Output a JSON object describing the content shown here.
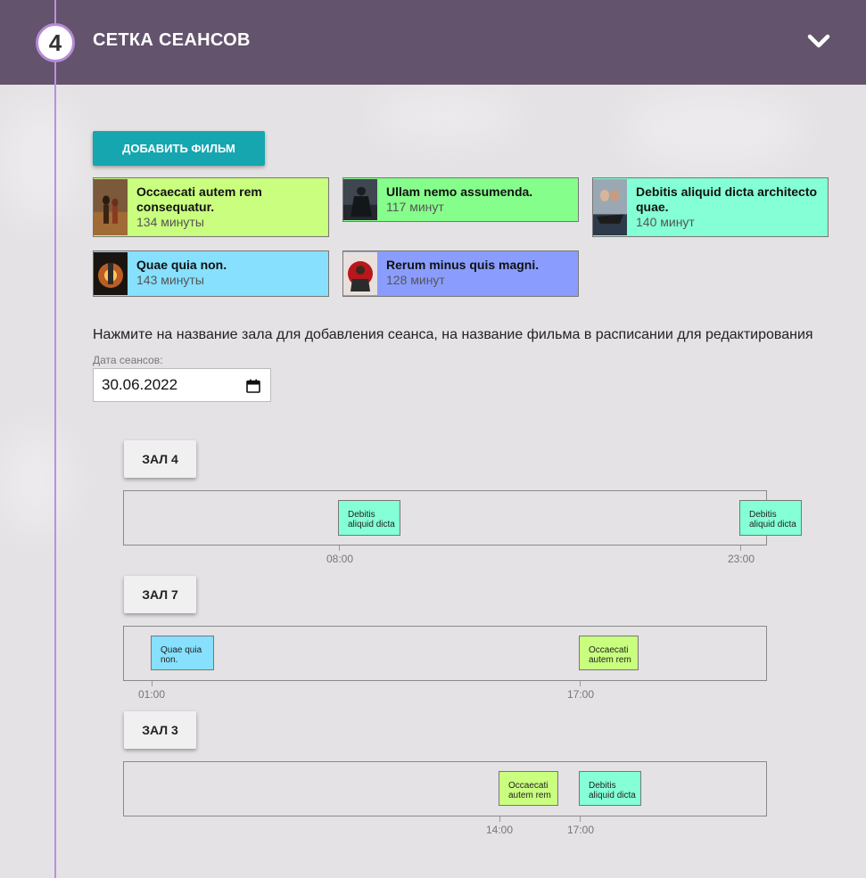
{
  "step": {
    "number": "4",
    "title": "СЕТКА СЕАНСОВ"
  },
  "header": {
    "collapse_icon": "chevron-down-icon"
  },
  "add_film_label": "ДОБАВИТЬ ФИЛЬМ",
  "movies": [
    {
      "title": "Occaecati autem rem consequatur.",
      "duration": "134 минуты",
      "color": "#c9fe7f"
    },
    {
      "title": "Ullam nemo assumenda.",
      "duration": "117 минут",
      "color": "#86fe8b"
    },
    {
      "title": "Debitis aliquid dicta architecto quae.",
      "duration": "140 минут",
      "color": "#84ffd6"
    },
    {
      "title": "Quae quia non.",
      "duration": "143 минуты",
      "color": "#86e0fe"
    },
    {
      "title": "Rerum minus quis magni.",
      "duration": "128 минут",
      "color": "#8a9dff"
    }
  ],
  "hint": "Нажмите на название зала для добавления сеанса, на название фильма в расписании для редактирования",
  "date": {
    "label": "Дата сеансов:",
    "value": "30.06.2022",
    "icon": "calendar-icon"
  },
  "halls": [
    {
      "name": "ЗАЛ 4",
      "sessions": [
        {
          "title": "Debitis aliquid dicta",
          "time": "08:00",
          "color": "#84ffd6"
        },
        {
          "title": "Debitis aliquid dicta",
          "time": "23:00",
          "color": "#84ffd6"
        }
      ]
    },
    {
      "name": "ЗАЛ 7",
      "sessions": [
        {
          "title": "Quae quia non.",
          "time": "01:00",
          "color": "#86e0fe"
        },
        {
          "title": "Occaecati autem rem",
          "time": "17:00",
          "color": "#c9fe7f"
        }
      ]
    },
    {
      "name": "ЗАЛ 3",
      "sessions": [
        {
          "title": "Occaecati autem rem",
          "time": "14:00",
          "color": "#c9fe7f"
        },
        {
          "title": "Debitis aliquid dicta",
          "time": "17:00",
          "color": "#84ffd6"
        }
      ]
    }
  ]
}
